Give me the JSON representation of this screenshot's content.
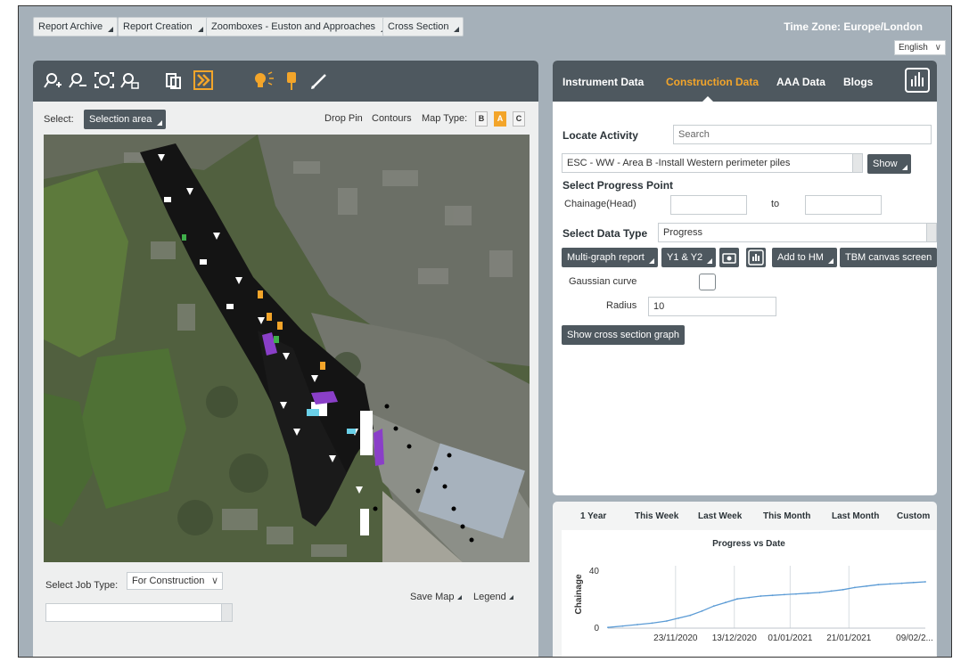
{
  "toolbar": {
    "buttons": [
      "Report Archive",
      "Report Creation",
      "Zoomboxes - Euston and Approaches",
      "Cross Section"
    ],
    "timezone": "Time Zone: Europe/London",
    "language": "English"
  },
  "map_panel": {
    "tools": [
      "zoom-in-icon",
      "zoom-out-icon",
      "zoom-extent-icon",
      "zoom-previous-icon",
      "layers-icon",
      "layer-toggle-icon",
      "lightbulb-icon",
      "pin-icon",
      "pencil-icon"
    ],
    "select_label": "Select:",
    "selection_button": "Selection area",
    "drop_pin": "Drop Pin",
    "contours": "Contours",
    "map_type_label": "Map Type:",
    "map_types": [
      "B",
      "A",
      "C"
    ],
    "active_map_type": "A",
    "job_type_label": "Select Job Type:",
    "job_type_value": "For Construction",
    "save_map": "Save Map",
    "legend": "Legend"
  },
  "right_panel": {
    "tabs": [
      "Instrument Data",
      "Construction Data",
      "AAA Data",
      "Blogs"
    ],
    "active_tab": "Construction Data",
    "locate_activity_label": "Locate Activity",
    "search_placeholder": "Search",
    "activity_value": "ESC - WW - Area B -Install Western perimeter piles",
    "show_button": "Show",
    "select_progress_point": "Select Progress Point",
    "chainage_label": "Chainage(Head)",
    "to_label": "to",
    "select_data_type": "Select Data Type",
    "data_type_value": "Progress",
    "multigraph_button": "Multi-graph report",
    "y1y2_button": "Y1 & Y2",
    "add_to_hm_button": "Add to HM",
    "tbm_button": "TBM canvas screen",
    "gaussian_label": "Gaussian curve",
    "radius_label": "Radius",
    "radius_value": "10",
    "cross_section_button": "Show cross section graph"
  },
  "chart_panel": {
    "ranges": [
      "1 Year",
      "This Week",
      "Last Week",
      "This Month",
      "Last Month",
      "Custom"
    ]
  },
  "chart_data": {
    "type": "line",
    "title": "Progress vs Date",
    "xlabel": "",
    "ylabel": "Chainage",
    "ylim": [
      0,
      40
    ],
    "yticks": [
      "0",
      "40"
    ],
    "xticks": [
      "23/11/2020",
      "13/12/2020",
      "01/01/2021",
      "21/01/2021",
      "09/02/2..."
    ],
    "grid": "vertical",
    "series": [
      {
        "points": [
          [
            "2020-10-31",
            0.5
          ],
          [
            "2020-11-05",
            1.5
          ],
          [
            "2020-11-10",
            2.5
          ],
          [
            "2020-11-15",
            3.5
          ],
          [
            "2020-11-20",
            5
          ],
          [
            "2020-11-24",
            7
          ],
          [
            "2020-11-28",
            9
          ],
          [
            "2020-12-02",
            12
          ],
          [
            "2020-12-06",
            15.5
          ],
          [
            "2020-12-10",
            18
          ],
          [
            "2020-12-14",
            20.5
          ],
          [
            "2020-12-18",
            21.5
          ],
          [
            "2020-12-22",
            22.5
          ],
          [
            "2020-12-26",
            23
          ],
          [
            "2020-12-30",
            23.5
          ],
          [
            "2021-01-03",
            24
          ],
          [
            "2021-01-07",
            24.5
          ],
          [
            "2021-01-11",
            25
          ],
          [
            "2021-01-15",
            26
          ],
          [
            "2021-01-19",
            27
          ],
          [
            "2021-01-23",
            28.5
          ],
          [
            "2021-01-27",
            29.5
          ],
          [
            "2021-01-31",
            30.5
          ],
          [
            "2021-02-04",
            31
          ],
          [
            "2021-02-08",
            31.5
          ],
          [
            "2021-02-12",
            32
          ],
          [
            "2021-02-16",
            32.5
          ]
        ]
      }
    ]
  }
}
